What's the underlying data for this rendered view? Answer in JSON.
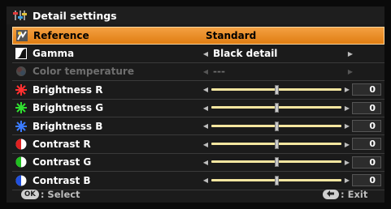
{
  "title": "Detail settings",
  "items": [
    {
      "label": "Reference",
      "value": "Standard",
      "type": "select",
      "state": "selected",
      "icon": "reference-icon"
    },
    {
      "label": "Gamma",
      "value": "Black detail",
      "type": "select",
      "state": "normal",
      "icon": "gamma-icon"
    },
    {
      "label": "Color temperature",
      "value": "---",
      "type": "select",
      "state": "disabled",
      "icon": "color-temperature-icon"
    },
    {
      "label": "Brightness R",
      "value": "0",
      "type": "slider",
      "level": 0.5,
      "state": "normal",
      "icon": "brightness-r-icon",
      "color": "#ff3030"
    },
    {
      "label": "Brightness G",
      "value": "0",
      "type": "slider",
      "level": 0.5,
      "state": "normal",
      "icon": "brightness-g-icon",
      "color": "#30e030"
    },
    {
      "label": "Brightness B",
      "value": "0",
      "type": "slider",
      "level": 0.5,
      "state": "normal",
      "icon": "brightness-b-icon",
      "color": "#3a7bff"
    },
    {
      "label": "Contrast R",
      "value": "0",
      "type": "slider",
      "level": 0.5,
      "state": "normal",
      "icon": "contrast-r-icon",
      "color": "#e02020"
    },
    {
      "label": "Contrast G",
      "value": "0",
      "type": "slider",
      "level": 0.5,
      "state": "normal",
      "icon": "contrast-g-icon",
      "color": "#20c020"
    },
    {
      "label": "Contrast B",
      "value": "0",
      "type": "slider",
      "level": 0.5,
      "state": "normal",
      "icon": "contrast-b-icon",
      "color": "#2050e0"
    }
  ],
  "footer": {
    "ok_key": "OK",
    "select_label": ": Select",
    "exit_label": ": Exit"
  },
  "colors": {
    "selected_bg": "#e07d12",
    "background": "#1b1b1b",
    "slider_track": "#f5e6a0"
  }
}
